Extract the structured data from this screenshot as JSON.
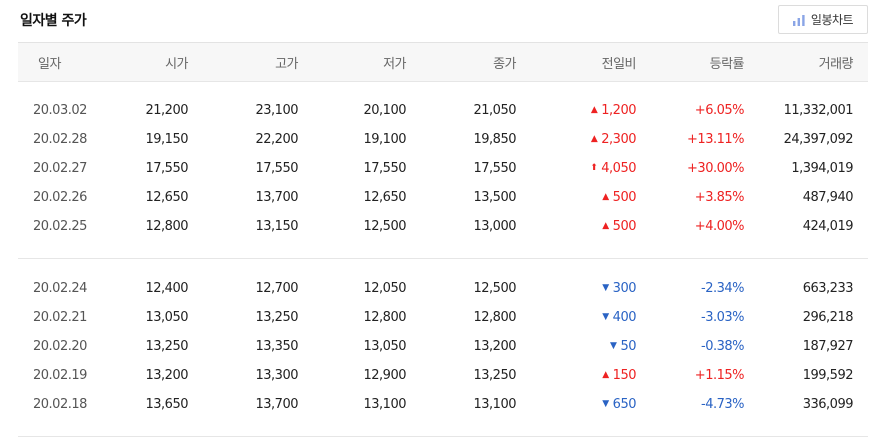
{
  "title": "일자별 주가",
  "chart_button": {
    "label": "일봉차트",
    "icon": "bar-chart-icon"
  },
  "columns": [
    "일자",
    "시가",
    "고가",
    "저가",
    "종가",
    "전일비",
    "등락률",
    "거래량"
  ],
  "colors": {
    "up": "#ee2222",
    "down": "#2a63c4"
  },
  "groups": [
    {
      "rows": [
        {
          "date": "20.03.02",
          "open": "21,200",
          "high": "23,100",
          "low": "20,100",
          "close": "21,050",
          "change": "1,200",
          "direction": "up",
          "rate": "+6.05%",
          "volume": "11,332,001"
        },
        {
          "date": "20.02.28",
          "open": "19,150",
          "high": "22,200",
          "low": "19,100",
          "close": "19,850",
          "change": "2,300",
          "direction": "up",
          "rate": "+13.11%",
          "volume": "24,397,092"
        },
        {
          "date": "20.02.27",
          "open": "17,550",
          "high": "17,550",
          "low": "17,550",
          "close": "17,550",
          "change": "4,050",
          "direction": "upper-limit",
          "rate": "+30.00%",
          "volume": "1,394,019"
        },
        {
          "date": "20.02.26",
          "open": "12,650",
          "high": "13,700",
          "low": "12,650",
          "close": "13,500",
          "change": "500",
          "direction": "up",
          "rate": "+3.85%",
          "volume": "487,940"
        },
        {
          "date": "20.02.25",
          "open": "12,800",
          "high": "13,150",
          "low": "12,500",
          "close": "13,000",
          "change": "500",
          "direction": "up",
          "rate": "+4.00%",
          "volume": "424,019"
        }
      ]
    },
    {
      "rows": [
        {
          "date": "20.02.24",
          "open": "12,400",
          "high": "12,700",
          "low": "12,050",
          "close": "12,500",
          "change": "300",
          "direction": "down",
          "rate": "-2.34%",
          "volume": "663,233"
        },
        {
          "date": "20.02.21",
          "open": "13,050",
          "high": "13,250",
          "low": "12,800",
          "close": "12,800",
          "change": "400",
          "direction": "down",
          "rate": "-3.03%",
          "volume": "296,218"
        },
        {
          "date": "20.02.20",
          "open": "13,250",
          "high": "13,350",
          "low": "13,050",
          "close": "13,200",
          "change": "50",
          "direction": "down",
          "rate": "-0.38%",
          "volume": "187,927"
        },
        {
          "date": "20.02.19",
          "open": "13,200",
          "high": "13,300",
          "low": "12,900",
          "close": "13,250",
          "change": "150",
          "direction": "up",
          "rate": "+1.15%",
          "volume": "199,592"
        },
        {
          "date": "20.02.18",
          "open": "13,650",
          "high": "13,700",
          "low": "13,100",
          "close": "13,100",
          "change": "650",
          "direction": "down",
          "rate": "-4.73%",
          "volume": "336,099"
        }
      ]
    }
  ]
}
